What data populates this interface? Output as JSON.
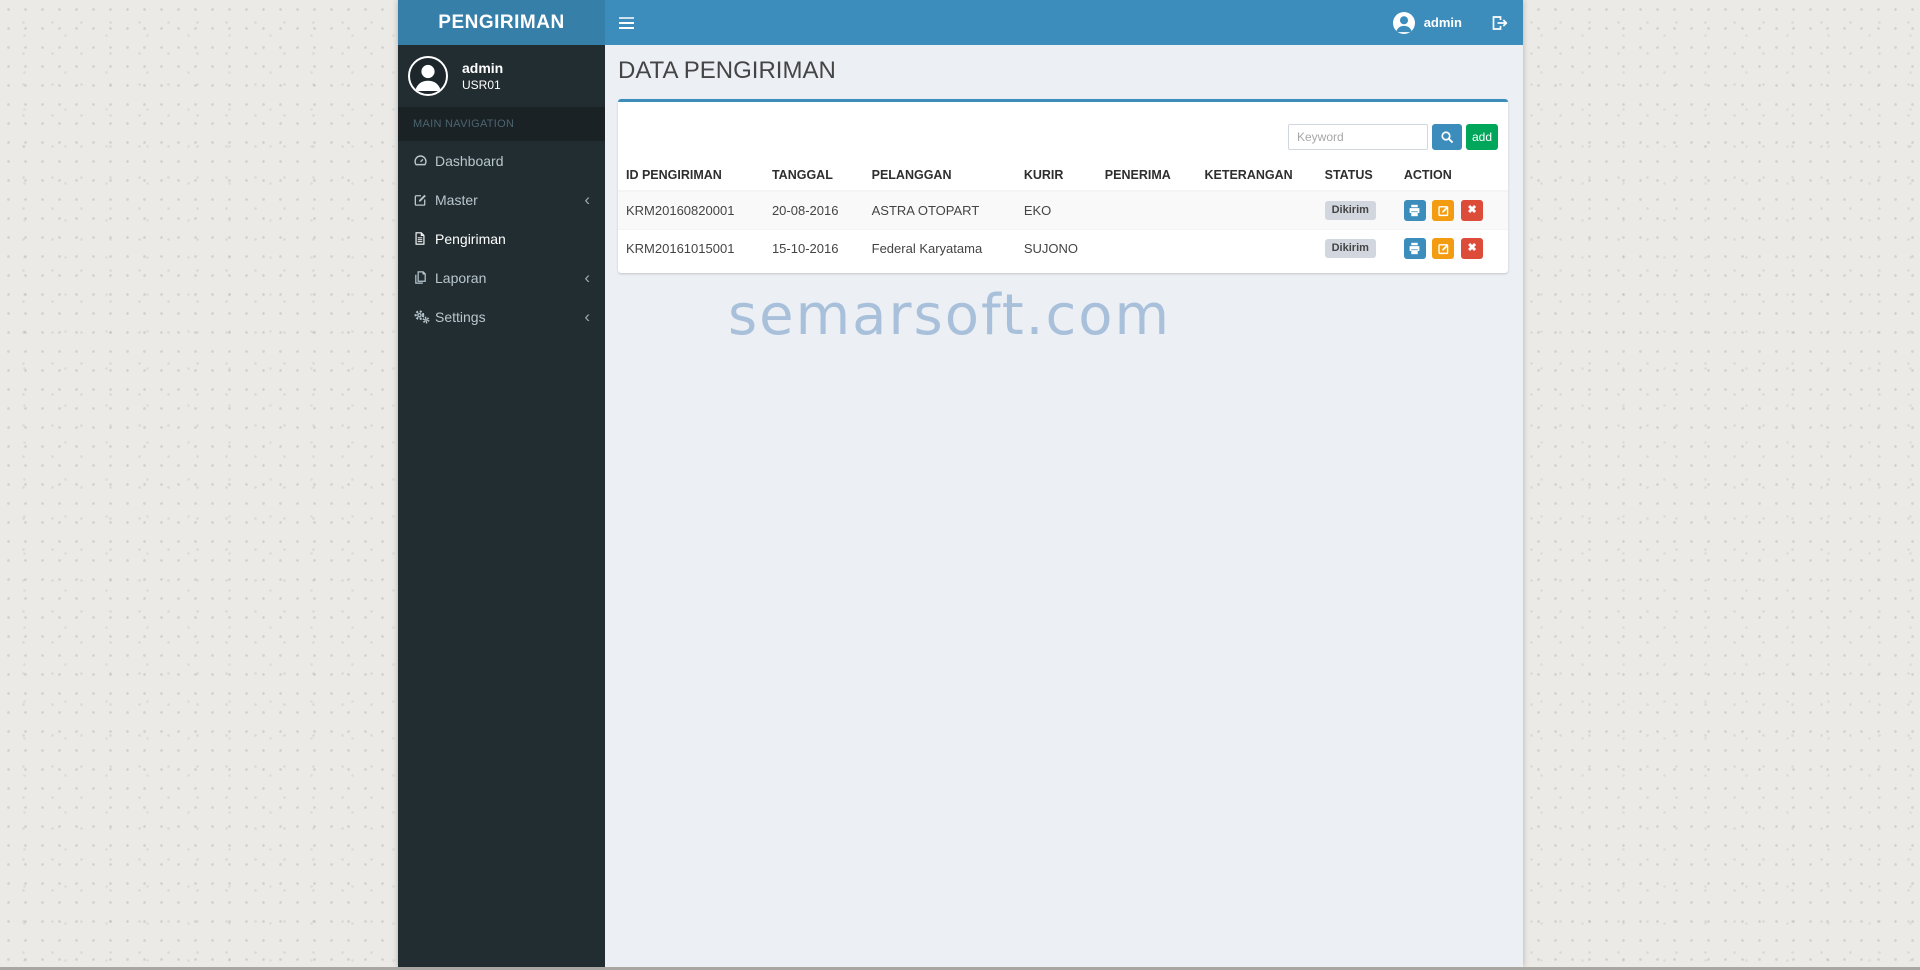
{
  "app": {
    "logo_title": "PENGIRIMAN",
    "navbar": {
      "user_name": "admin"
    },
    "sidebar": {
      "user_name": "admin",
      "user_id": "USR01",
      "section_header": "MAIN NAVIGATION",
      "items": [
        {
          "label": "Dashboard",
          "chevron": ""
        },
        {
          "label": "Master",
          "chevron": "‹"
        },
        {
          "label": "Pengiriman",
          "chevron": ""
        },
        {
          "label": "Laporan",
          "chevron": "‹"
        },
        {
          "label": "Settings",
          "chevron": "‹"
        }
      ]
    },
    "content": {
      "page_title": "DATA PENGIRIMAN",
      "toolbar": {
        "search_placeholder": "Keyword",
        "add_button_label": "add"
      },
      "table": {
        "columns": [
          "ID PENGIRIMAN",
          "TANGGAL",
          "PELANGGAN",
          "KURIR",
          "PENERIMA",
          "KETERANGAN",
          "STATUS",
          "ACTION"
        ],
        "rows": [
          {
            "id_pengiriman": "KRM20160820001",
            "tanggal": "20-08-2016",
            "pelanggan": "ASTRA OTOPART",
            "kurir": "EKO",
            "penerima": "",
            "keterangan": "",
            "status": "Dikirim"
          },
          {
            "id_pengiriman": "KRM20161015001",
            "tanggal": "15-10-2016",
            "pelanggan": "Federal Karyatama",
            "kurir": "SUJONO",
            "penerima": "",
            "keterangan": "",
            "status": "Dikirim"
          }
        ]
      }
    },
    "watermark": "semarsoft.com",
    "icons": {
      "delete_glyph": "✖"
    },
    "colors": {
      "accent_blue": "#3c8dbc",
      "logo_bg": "#367fa9",
      "sidebar_bg": "#222d32",
      "menu_header_bg": "#1a2226",
      "content_bg": "#ecf0f5",
      "add_green": "#00a65a",
      "edit_orange": "#f39c12",
      "delete_red": "#dd4b39",
      "badge_gray": "#d2d6de",
      "watermark_blue": "#a9c0db"
    }
  }
}
